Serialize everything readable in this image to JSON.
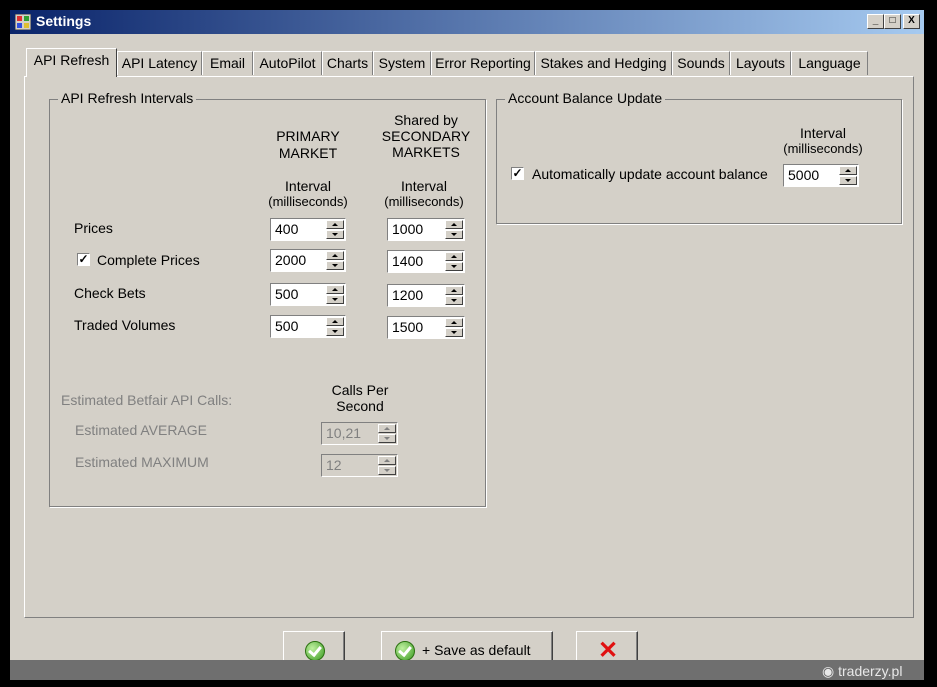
{
  "window": {
    "title": "Settings",
    "min_label": "_",
    "max_label": "□",
    "close_label": "X"
  },
  "tabs": [
    {
      "label": "API Refresh"
    },
    {
      "label": "API Latency"
    },
    {
      "label": "Email"
    },
    {
      "label": "AutoPilot"
    },
    {
      "label": "Charts"
    },
    {
      "label": "System"
    },
    {
      "label": "Error Reporting"
    },
    {
      "label": "Stakes and Hedging"
    },
    {
      "label": "Sounds"
    },
    {
      "label": "Layouts"
    },
    {
      "label": "Language"
    }
  ],
  "refresh": {
    "group_title": "API Refresh Intervals",
    "primary_header": [
      "PRIMARY",
      "MARKET"
    ],
    "secondary_header": [
      "Shared by",
      "SECONDARY",
      "MARKETS"
    ],
    "interval_label": [
      "Interval",
      "(milliseconds)"
    ],
    "rows": [
      {
        "label": "Prices",
        "primary": "400",
        "secondary": "1000"
      },
      {
        "label": "Complete Prices",
        "primary": "2000",
        "secondary": "1400",
        "checked": true
      },
      {
        "label": "Check Bets",
        "primary": "500",
        "secondary": "1200"
      },
      {
        "label": "Traded Volumes",
        "primary": "500",
        "secondary": "1500"
      }
    ],
    "estimated_title": "Estimated Betfair API Calls:",
    "calls_header": [
      "Calls Per",
      "Second"
    ],
    "average_label": "Estimated AVERAGE",
    "average_value": "10,21",
    "maximum_label": "Estimated MAXIMUM",
    "maximum_value": "12"
  },
  "balance": {
    "group_title": "Account Balance Update",
    "interval_label": [
      "Interval",
      "(milliseconds)"
    ],
    "auto_label": "Automatically update account balance",
    "auto_checked": true,
    "value": "5000"
  },
  "buttons": {
    "save_default_label": "+ Save as default"
  },
  "watermark": "traderzy.pl",
  "icons": {
    "ok": "check-circle-icon",
    "cancel": "red-x-icon"
  }
}
